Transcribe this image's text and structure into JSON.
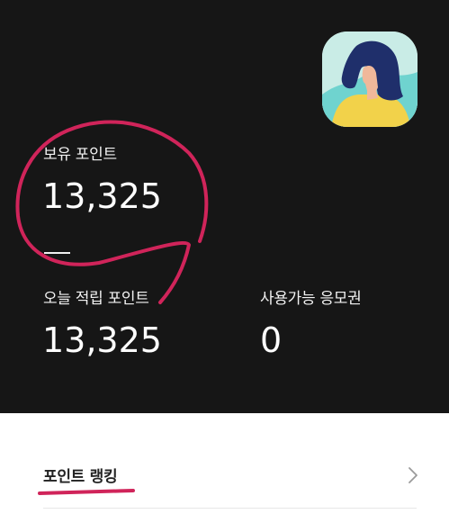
{
  "points": {
    "held_label": "보유 포인트",
    "held_value": "13,325",
    "today_label": "오늘 적립 포인트",
    "today_value": "13,325",
    "vouchers_label": "사용가능 응모권",
    "vouchers_value": "0"
  },
  "ranking": {
    "label": "포인트 랭킹",
    "chevron_icon": "chevron-right-icon"
  },
  "avatar": {
    "icon": "profile-avatar-icon"
  },
  "colors": {
    "panel_bg": "#161616",
    "annotation": "#d0245a",
    "avatar_bg": "#c9ece6"
  }
}
